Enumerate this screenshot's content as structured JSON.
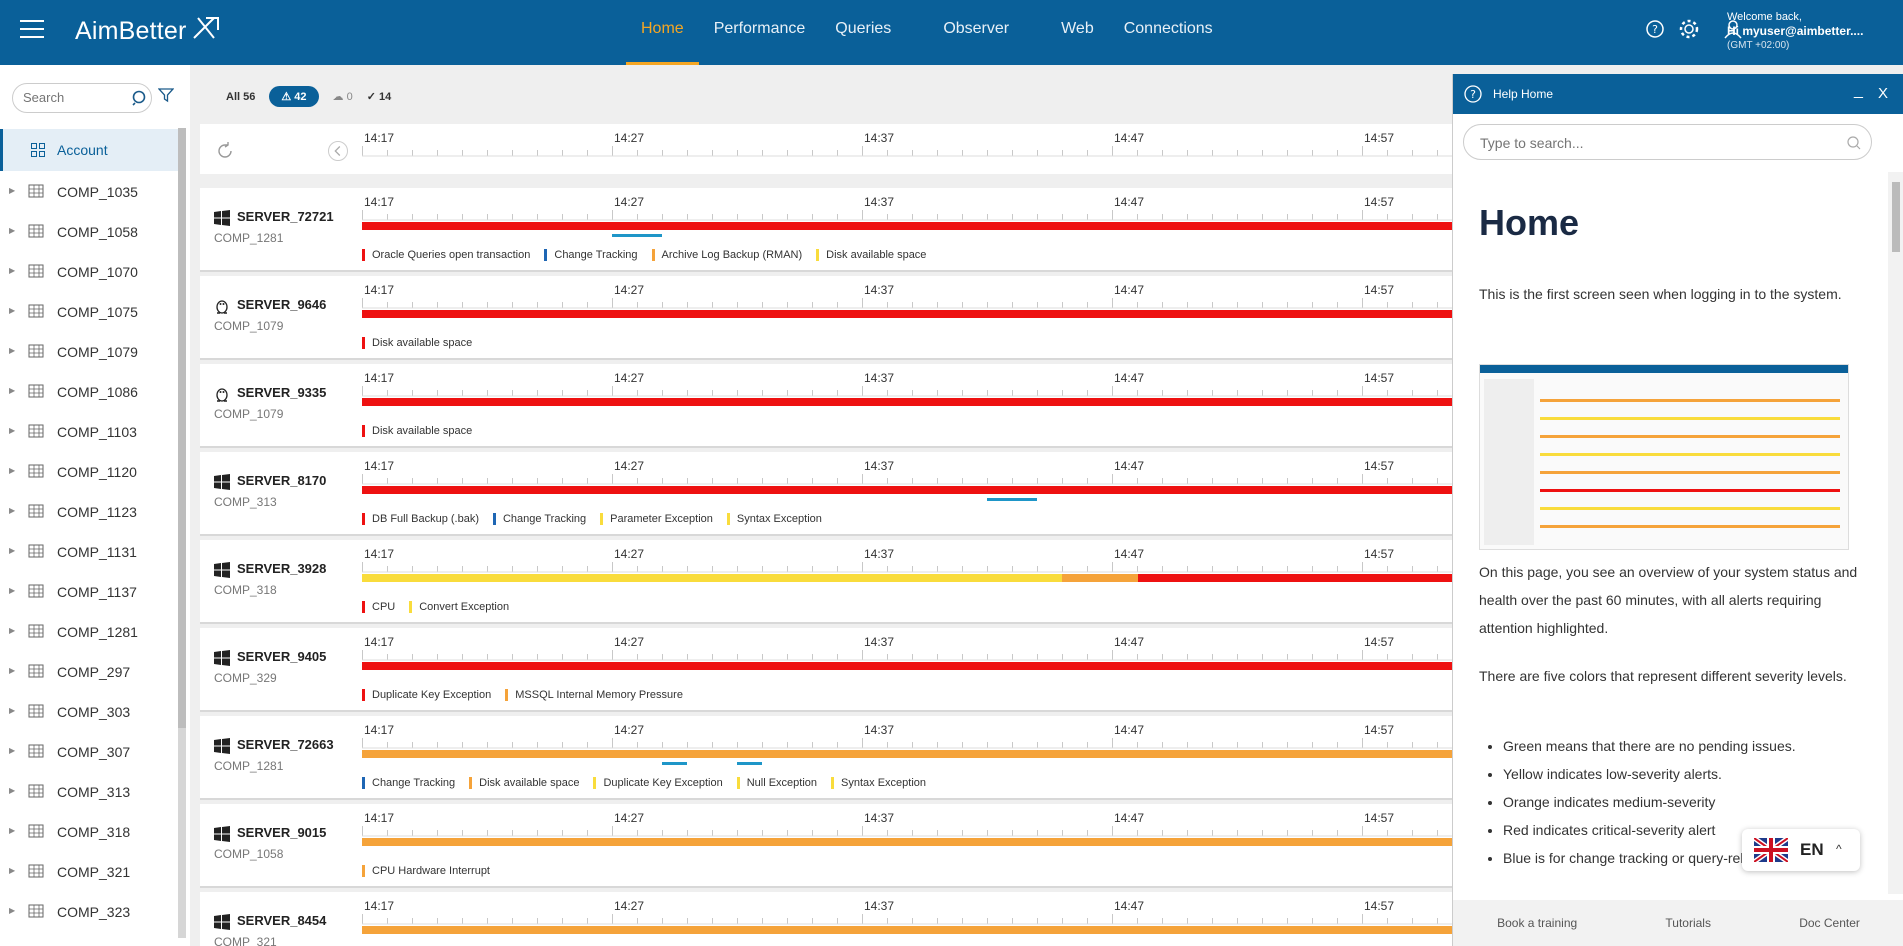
{
  "app": {
    "logo": "AimBetter"
  },
  "nav": [
    {
      "label": "Home",
      "active": true
    },
    {
      "label": "Performance",
      "active": false
    },
    {
      "label": "Queries",
      "active": false
    },
    {
      "label": "Observer",
      "active": false
    },
    {
      "label": "Web",
      "active": false
    },
    {
      "label": "Connections",
      "active": false
    }
  ],
  "user": {
    "welcome": "Welcome back,",
    "name": "Hi myuser@aimbetter....",
    "tz": "(GMT +02:00)"
  },
  "sidebar": {
    "search_placeholder": "Search",
    "account_label": "Account",
    "companies": [
      "COMP_1035",
      "COMP_1058",
      "COMP_1070",
      "COMP_1075",
      "COMP_1079",
      "COMP_1086",
      "COMP_1103",
      "COMP_1120",
      "COMP_1123",
      "COMP_1131",
      "COMP_1137",
      "COMP_1281",
      "COMP_297",
      "COMP_303",
      "COMP_307",
      "COMP_313",
      "COMP_318",
      "COMP_321",
      "COMP_323"
    ]
  },
  "filters": {
    "all": "All 56",
    "alerts": "42",
    "cloud": "0",
    "check": "14"
  },
  "timeline": {
    "ticks": [
      "14:17",
      "14:27",
      "14:37",
      "14:47",
      "14:57"
    ]
  },
  "colors": {
    "red": "#ee1111",
    "orange": "#f5a33a",
    "yellow": "#f9dc3c",
    "blue": "#1e66b4",
    "brand": "#0a6099"
  },
  "servers": [
    {
      "name": "SERVER_72721",
      "os": "windows",
      "comp": "COMP_1281",
      "bar": "red",
      "legend": [
        [
          "Oracle Queries open transaction",
          "red"
        ],
        [
          "Change Tracking",
          "blue"
        ],
        [
          "Archive Log Backup (RMAN)",
          "orange"
        ],
        [
          "Disk available space",
          "yellow"
        ]
      ]
    },
    {
      "name": "SERVER_9646",
      "os": "linux",
      "comp": "COMP_1079",
      "bar": "red",
      "legend": [
        [
          "Disk available space",
          "red"
        ]
      ]
    },
    {
      "name": "SERVER_9335",
      "os": "linux",
      "comp": "COMP_1079",
      "bar": "red",
      "legend": [
        [
          "Disk available space",
          "red"
        ]
      ]
    },
    {
      "name": "SERVER_8170",
      "os": "windows",
      "comp": "COMP_313",
      "bar": "red",
      "legend": [
        [
          "DB Full Backup (.bak)",
          "red"
        ],
        [
          "Change Tracking",
          "blue"
        ],
        [
          "Parameter Exception",
          "yellow"
        ],
        [
          "Syntax Exception",
          "yellow"
        ]
      ]
    },
    {
      "name": "SERVER_3928",
      "os": "windows",
      "comp": "COMP_318",
      "bar": "mixed",
      "legend": [
        [
          "CPU",
          "red"
        ],
        [
          "Convert Exception",
          "yellow"
        ]
      ]
    },
    {
      "name": "SERVER_9405",
      "os": "windows",
      "comp": "COMP_329",
      "bar": "red",
      "legend": [
        [
          "Duplicate Key Exception",
          "red"
        ],
        [
          "MSSQL Internal Memory Pressure",
          "orange"
        ]
      ]
    },
    {
      "name": "SERVER_72663",
      "os": "windows",
      "comp": "COMP_1281",
      "bar": "orange",
      "legend": [
        [
          "Change Tracking",
          "blue"
        ],
        [
          "Disk available space",
          "orange"
        ],
        [
          "Duplicate Key Exception",
          "yellow"
        ],
        [
          "Null Exception",
          "yellow"
        ],
        [
          "Syntax Exception",
          "yellow"
        ]
      ]
    },
    {
      "name": "SERVER_9015",
      "os": "windows",
      "comp": "COMP_1058",
      "bar": "orange",
      "legend": [
        [
          "CPU Hardware Interrupt",
          "orange"
        ]
      ]
    },
    {
      "name": "SERVER_8454",
      "os": "windows",
      "comp": "COMP_321",
      "bar": "orange",
      "legend": []
    }
  ],
  "help": {
    "title": "Help Home",
    "min": "_",
    "close": "X",
    "search_placeholder": "Type to search...",
    "h1": "Home",
    "p1": "This is the first screen seen when logging in to the system.",
    "p2": "On this page, you see an overview of your system status and health over the past 60 minutes, with all alerts requiring attention highlighted.",
    "p3": "There are five colors that represent different severity levels.",
    "list": [
      "Green means that there are no pending issues.",
      "Yellow indicates low-severity alerts.",
      "Orange indicates medium-severity",
      "Red indicates critical-severity alert",
      "Blue is for change tracking or query-related"
    ],
    "footer": [
      "Book a training",
      "Tutorials",
      "Doc Center"
    ]
  },
  "lang": {
    "code": "EN"
  }
}
